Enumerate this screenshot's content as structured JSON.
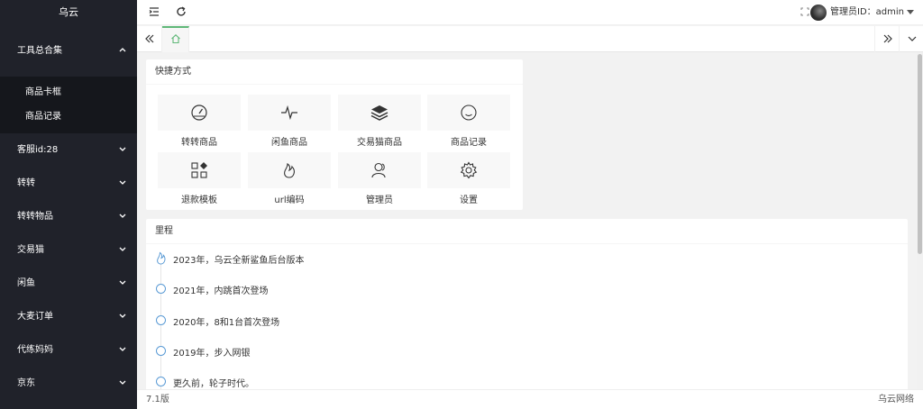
{
  "sidebar": {
    "logo": "乌云",
    "group_open": {
      "label": "工具总合集",
      "children": [
        "商品卡框",
        "商品记录"
      ]
    },
    "items": [
      "客服id:28",
      "转转",
      "转转物品",
      "交易猫",
      "闲鱼",
      "大麦订单",
      "代练妈妈",
      "京东"
    ]
  },
  "header": {
    "icons": [
      "indent-icon",
      "refresh-icon",
      "fullscreen-icon"
    ],
    "user_label": "管理员ID：admin"
  },
  "tabbar": {
    "home_icon": "home-icon"
  },
  "shortcuts": {
    "title": "快捷方式",
    "items": [
      {
        "label": "转转商品",
        "icon": "dashboard-icon"
      },
      {
        "label": "闲鱼商品",
        "icon": "pulse-icon"
      },
      {
        "label": "交易猫商品",
        "icon": "layers-icon"
      },
      {
        "label": "商品记录",
        "icon": "smile-icon"
      },
      {
        "label": "退款模板",
        "icon": "apps-icon"
      },
      {
        "label": "url编码",
        "icon": "fire-icon"
      },
      {
        "label": "管理员",
        "icon": "users-icon"
      },
      {
        "label": "设置",
        "icon": "gear-icon"
      }
    ]
  },
  "timeline": {
    "title": "里程",
    "items": [
      "2023年，乌云全新鲨鱼后台版本",
      "2021年，内跳首次登场",
      "2020年，8和1台首次登场",
      "2019年，步入网银",
      "更久前，轮子时代。"
    ]
  },
  "footer": {
    "version": "7.1版",
    "brand": "乌云网络"
  },
  "colors": {
    "sidebar_bg": "#20222a",
    "submenu_bg": "#15171c",
    "accent": "#5fb878",
    "timeline_dot": "#5b9bd5"
  }
}
